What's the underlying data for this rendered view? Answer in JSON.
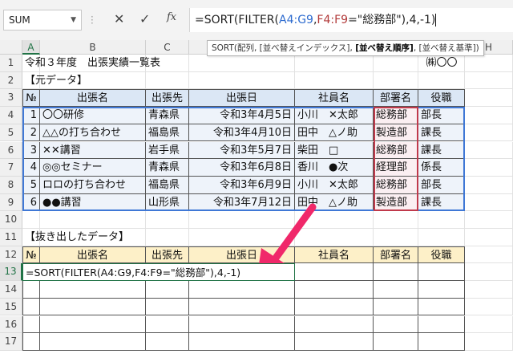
{
  "name_box": "SUM",
  "formula_bar": {
    "prefix": "=SORT(FILTER(",
    "ref1": "A4:G9",
    "mid": ",",
    "ref2": "F4:F9",
    "suffix": "=\"総務部\"),4,-1",
    "close": ")"
  },
  "icons": {
    "cancel": "cancel-icon",
    "enter": "check-icon",
    "fx": "fx-icon",
    "dropdown": "chevron-down-icon"
  },
  "tooltip": {
    "pre": "SORT(配列, [並べ替えインデックス], ",
    "bold": "[並べ替え順序]",
    "post": ", [並べ替え基準])"
  },
  "columns": [
    "A",
    "B",
    "C",
    "D",
    "E",
    "F",
    "G",
    "H"
  ],
  "rows": [
    "1",
    "2",
    "3",
    "4",
    "5",
    "6",
    "7",
    "8",
    "9",
    "10",
    "11",
    "12",
    "13",
    "14",
    "15",
    "16",
    "17"
  ],
  "sheet": {
    "title": "令和３年度　出張実績一覧表",
    "company": "㈱〇〇",
    "src_label": "【元データ】",
    "headers": [
      "№",
      "出張名",
      "出張先",
      "出張日",
      "社員名",
      "部署名",
      "役職"
    ],
    "records": [
      [
        "1",
        "〇〇研修",
        "青森県",
        "令和3年4月5日",
        "小川　✕太郎",
        "総務部",
        "部長"
      ],
      [
        "2",
        "△△の打ち合わせ",
        "福島県",
        "令和3年4月10日",
        "田中　△ノ助",
        "製造部",
        "課長"
      ],
      [
        "3",
        "✕✕講習",
        "岩手県",
        "令和3年5月7日",
        "柴田　□",
        "総務部",
        "課長"
      ],
      [
        "4",
        "◎◎セミナー",
        "青森県",
        "令和3年6月8日",
        "香川　●次",
        "経理部",
        "係長"
      ],
      [
        "5",
        "ロロの打ち合わせ",
        "福島県",
        "令和3年6月9日",
        "小川　✕太郎",
        "総務部",
        "部長"
      ],
      [
        "6",
        "●●講習",
        "山形県",
        "令和3年7月12日",
        "田中　△ノ助",
        "製造部",
        "課長"
      ]
    ],
    "out_label": "【抜き出したデータ】",
    "out_headers": [
      "№",
      "出張名",
      "出張先",
      "出張日",
      "社員名",
      "部署名",
      "役職"
    ],
    "formula_cell": "=SORT(FILTER(A4:G9,F4:F9=\"総務部\"),4,-1)"
  }
}
